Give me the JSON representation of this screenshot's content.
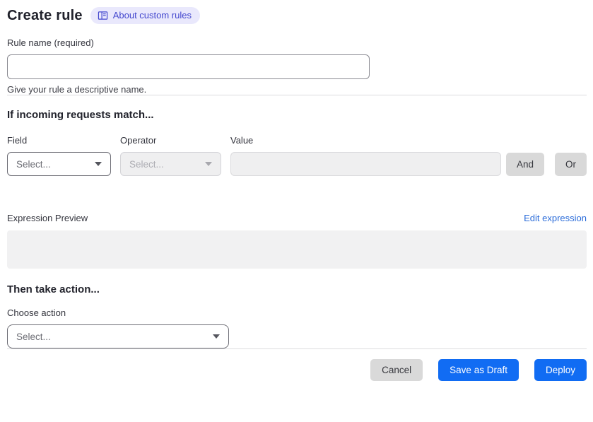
{
  "colors": {
    "primary_blue": "#116cf3",
    "link_blue": "#2b6cd9",
    "badge_bg": "#e9e8fc",
    "badge_text": "#4347ce",
    "gray_button_bg": "#d9d9d9",
    "disabled_bg": "#efeff0",
    "preview_bg": "#f1f1f2"
  },
  "header": {
    "title": "Create rule",
    "badge": {
      "icon": "book-icon",
      "label": "About custom rules"
    }
  },
  "rule_name": {
    "label": "Rule name (required)",
    "value": "",
    "helper": "Give your rule a descriptive name."
  },
  "match": {
    "heading": "If incoming requests match...",
    "field": {
      "label": "Field",
      "selected": "Select..."
    },
    "operator": {
      "label": "Operator",
      "selected": "Select...",
      "disabled": true
    },
    "value": {
      "label": "Value",
      "value": "",
      "disabled": true
    },
    "and_button": "And",
    "or_button": "Or"
  },
  "expression": {
    "preview_label": "Expression Preview",
    "edit_link": "Edit expression",
    "preview_content": ""
  },
  "action": {
    "heading": "Then take action...",
    "label": "Choose action",
    "selected": "Select..."
  },
  "footer": {
    "cancel_button": "Cancel",
    "save_draft_button": "Save as Draft",
    "deploy_button": "Deploy"
  }
}
